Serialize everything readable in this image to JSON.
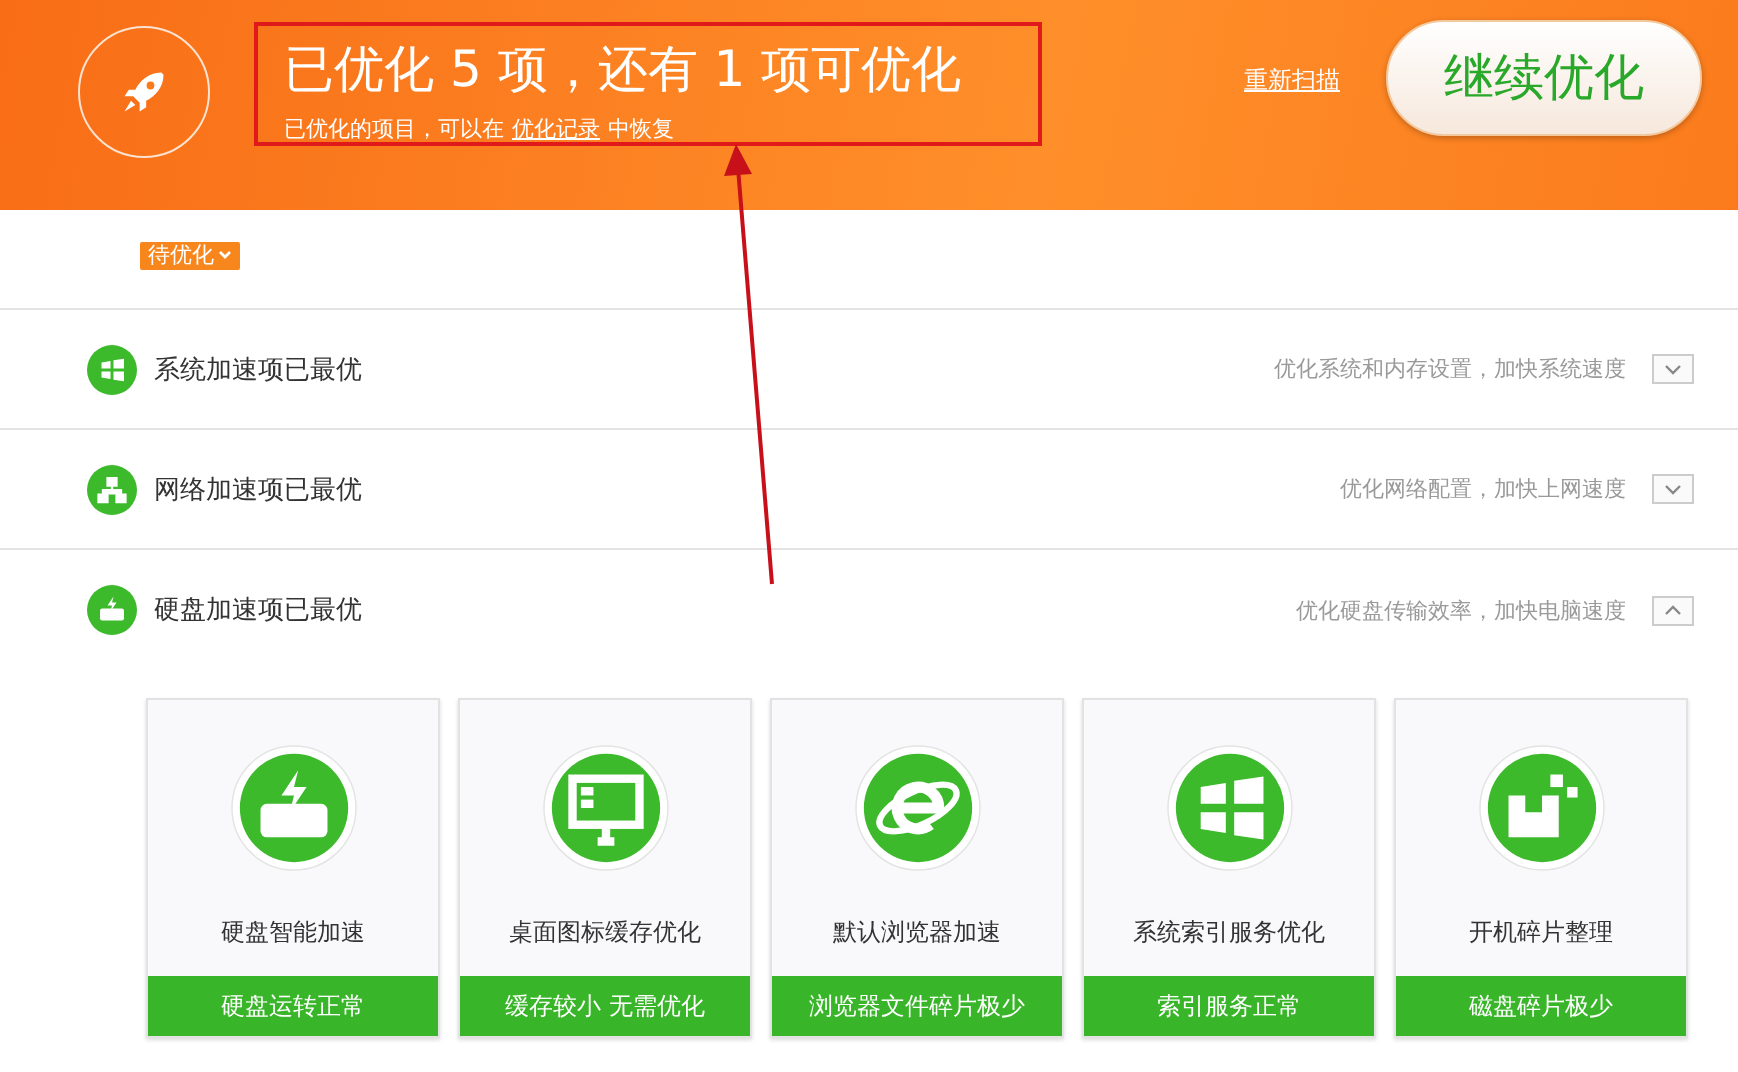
{
  "header": {
    "title": "已优化 5 项，还有 1 项可优化",
    "subtitle_before": "已优化的项目，可以在",
    "subtitle_link": "优化记录",
    "subtitle_after": "中恢复",
    "rescan_link": "重新扫描",
    "continue_button": "继续优化"
  },
  "pending_badge": "待优化",
  "sections": [
    {
      "title": "系统加速项已最优",
      "description": "优化系统和内存设置，加快系统速度",
      "expanded": false
    },
    {
      "title": "网络加速项已最优",
      "description": "优化网络配置，加快上网速度",
      "expanded": false
    },
    {
      "title": "硬盘加速项已最优",
      "description": "优化硬盘传输效率，加快电脑速度",
      "expanded": true,
      "cards": [
        {
          "title": "硬盘智能加速",
          "status": "硬盘运转正常"
        },
        {
          "title": "桌面图标缓存优化",
          "status": "缓存较小 无需优化"
        },
        {
          "title": "默认浏览器加速",
          "status": "浏览器文件碎片极少"
        },
        {
          "title": "系统索引服务优化",
          "status": "索引服务正常"
        },
        {
          "title": "开机碎片整理",
          "status": "磁盘碎片极少"
        }
      ]
    }
  ]
}
